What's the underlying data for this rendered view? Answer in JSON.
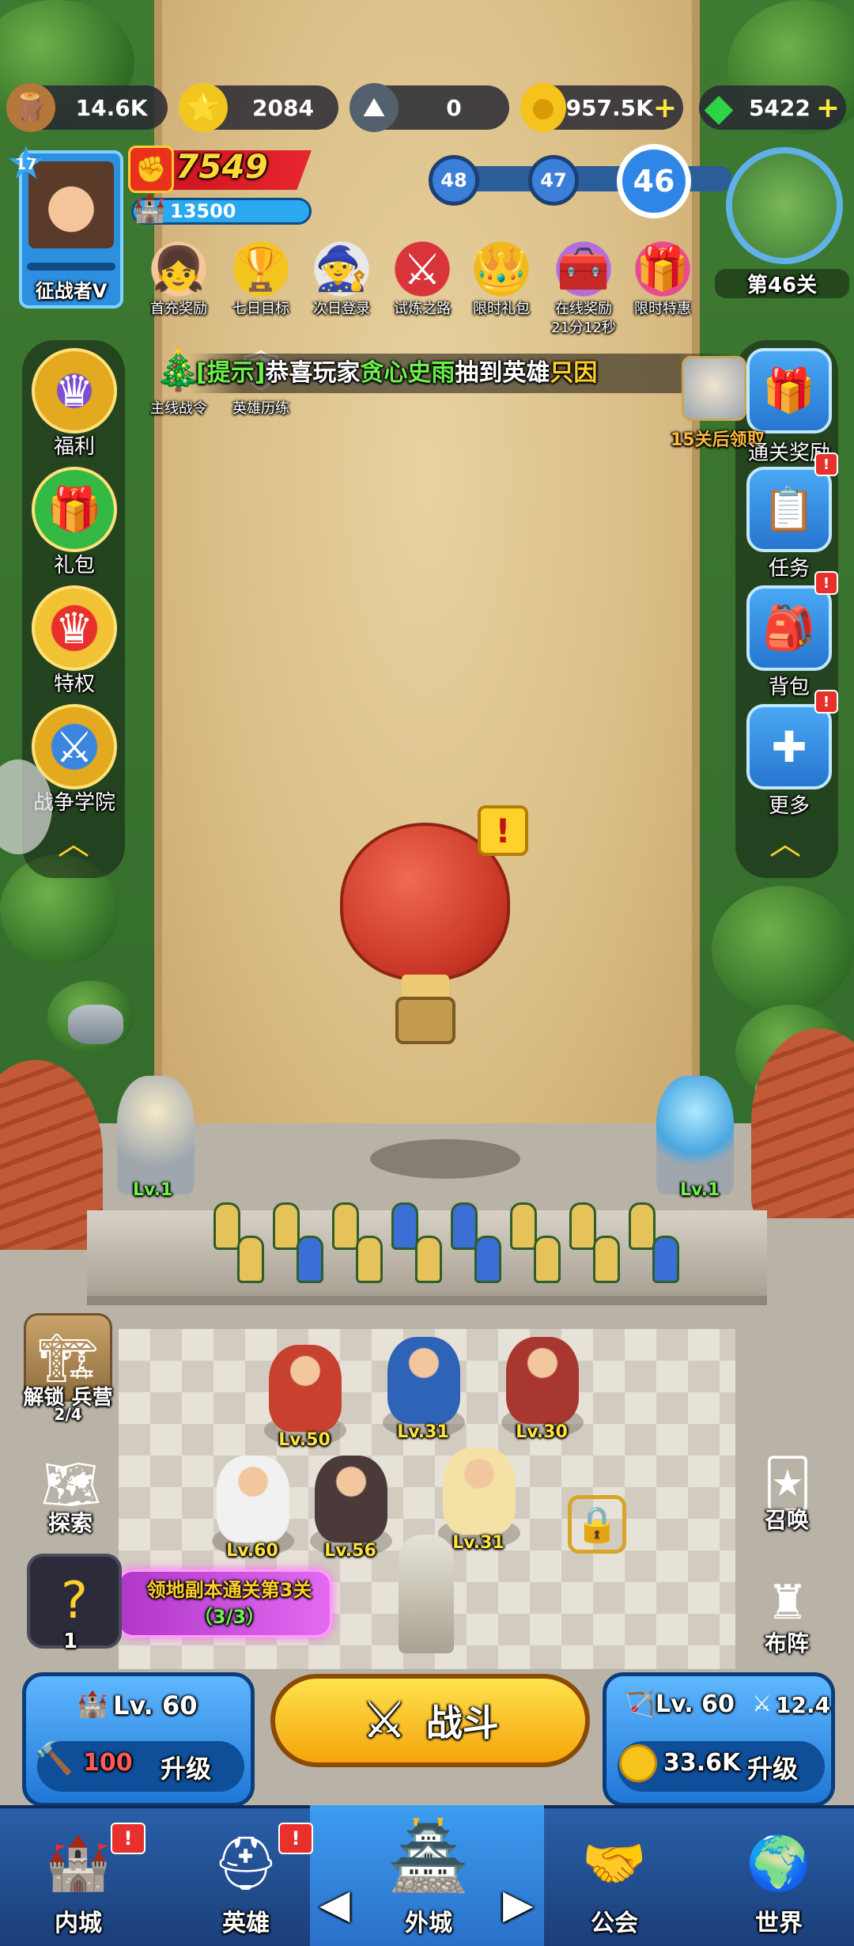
{
  "resources": [
    {
      "icon": "wood-icon",
      "glyph": "🪵",
      "value": "14.6K"
    },
    {
      "icon": "star-coin-icon",
      "glyph": "⭐",
      "value": "2084"
    },
    {
      "icon": "iron-icon",
      "glyph": "⛰",
      "value": "0"
    },
    {
      "icon": "gold-coin-icon",
      "glyph": "●",
      "value": "957.5K"
    },
    {
      "icon": "gem-icon",
      "glyph": "◆",
      "value": "5422"
    }
  ],
  "player": {
    "level": "17",
    "title": "征战者Ⅴ",
    "power": "7549",
    "population": "13500"
  },
  "stage": {
    "prev2": "48",
    "prev1": "47",
    "current": "46",
    "label": "第46关"
  },
  "events": [
    {
      "label": "首充奖励",
      "glyph": "👧"
    },
    {
      "label": "七日目标",
      "glyph": "🏆"
    },
    {
      "label": "次日登录",
      "glyph": "🧙"
    },
    {
      "label": "试炼之路",
      "glyph": "⚔"
    },
    {
      "label": "限时礼包",
      "glyph": "👑"
    },
    {
      "label": "在线奖励",
      "sub": "21分12秒",
      "glyph": "🧰"
    },
    {
      "label": "限时特惠",
      "glyph": "🎁"
    }
  ],
  "events2": [
    {
      "label": "主线战令",
      "glyph": "🎄"
    },
    {
      "label": "英雄历练",
      "glyph": "🛡"
    }
  ],
  "marquee": {
    "tag": "[提示]",
    "text1": "恭喜玩家",
    "name": "贪心史雨",
    "text2": "抽到英雄",
    "hero": "只因"
  },
  "left_menu": [
    {
      "label": "福利",
      "glyph": "♛"
    },
    {
      "label": "礼包",
      "glyph": "🎁"
    },
    {
      "label": "特权",
      "glyph": "♛"
    },
    {
      "label": "战争学院",
      "glyph": "⚔"
    }
  ],
  "right_menu": {
    "clear_reward": {
      "label": "通关奖励",
      "note": "15关后领取",
      "glyph": "🎁"
    },
    "items": [
      {
        "label": "任务",
        "glyph": "📋",
        "badge": "!"
      },
      {
        "label": "背包",
        "glyph": "🎒",
        "badge": "!"
      },
      {
        "label": "更多",
        "glyph": "✚",
        "badge": "!"
      }
    ]
  },
  "towers": {
    "left": "Lv.1",
    "right": "Lv.1"
  },
  "heroes": [
    "Lv.50",
    "Lv.31",
    "Lv.30",
    "Lv.60",
    "Lv.56",
    "Lv.31"
  ],
  "barracks": {
    "label": "解锁 兵营",
    "progress": "2/4"
  },
  "explore": {
    "label": "探索"
  },
  "quest": {
    "count": "1",
    "title": "领地副本通关第3关",
    "progress": "（3/3）"
  },
  "summon": {
    "label": "召唤"
  },
  "formation": {
    "label": "布阵"
  },
  "left_upgrade": {
    "level": "Lv. 60",
    "cost": "100",
    "action": "升级"
  },
  "battle_label": "战斗",
  "right_upgrade": {
    "level": "Lv. 60",
    "power": "12.4",
    "cost": "33.6K",
    "action": "升级"
  },
  "nav": [
    {
      "label": "内城",
      "glyph": "🏰",
      "badge": "!"
    },
    {
      "label": "英雄",
      "glyph": "⛑",
      "badge": "!"
    },
    {
      "label": "外城",
      "glyph": "🏯"
    },
    {
      "label": "公会",
      "glyph": "🤝"
    },
    {
      "label": "世界",
      "glyph": "🌍"
    }
  ],
  "colors": {
    "power_red": "#e8262f",
    "gold": "#ffd835",
    "nav_blue": "#2a5fa8",
    "battle_yellow": "#f5a50b",
    "highlight_green": "#6cf04a",
    "highlight_gold": "#ffd02a"
  }
}
